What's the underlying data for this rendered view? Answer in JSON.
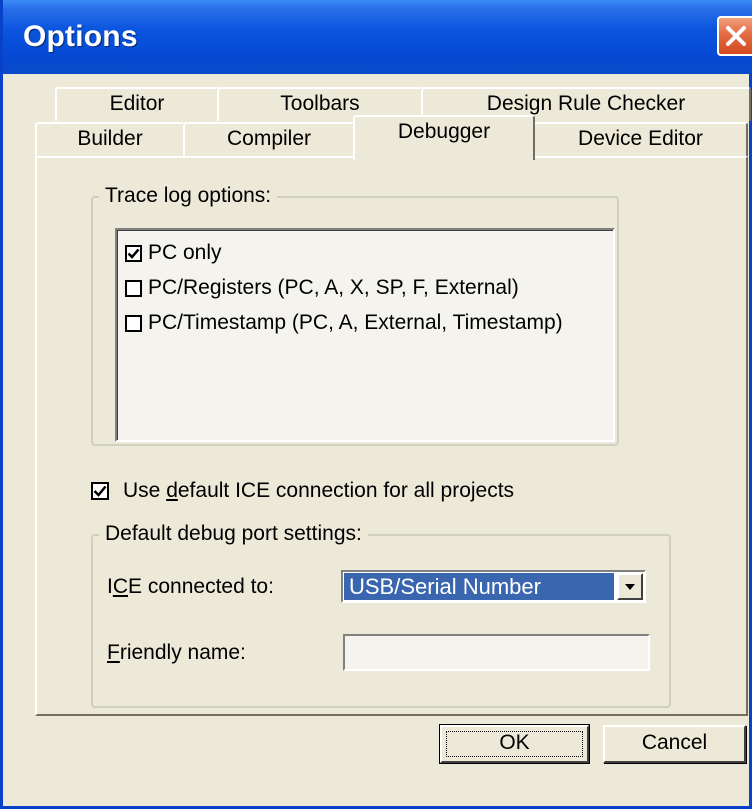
{
  "window": {
    "title": "Options"
  },
  "tabs": {
    "row1": [
      "Editor",
      "Toolbars",
      "Design Rule Checker"
    ],
    "row2": [
      "Builder",
      "Compiler",
      "Debugger",
      "Device Editor"
    ],
    "active": "Debugger"
  },
  "trace_log": {
    "label": "Trace log options:",
    "options": [
      {
        "label": "PC only",
        "checked": true
      },
      {
        "label": "PC/Registers (PC, A, X, SP, F, External)",
        "checked": false
      },
      {
        "label": "PC/Timestamp (PC, A, External, Timestamp)",
        "checked": false
      }
    ]
  },
  "default_ice": {
    "pre": "Use ",
    "accel": "d",
    "post": "efault ICE connection for all projects",
    "checked": true
  },
  "debug_port": {
    "label": "Default debug port settings:",
    "ice_label_pre": "I",
    "ice_label_accel": "C",
    "ice_label_post": "E connected to:",
    "ice_value": "USB/Serial Number",
    "friendly_accel": "F",
    "friendly_post": "riendly name:",
    "friendly_value": ""
  },
  "buttons": {
    "ok": "OK",
    "cancel": "Cancel"
  }
}
